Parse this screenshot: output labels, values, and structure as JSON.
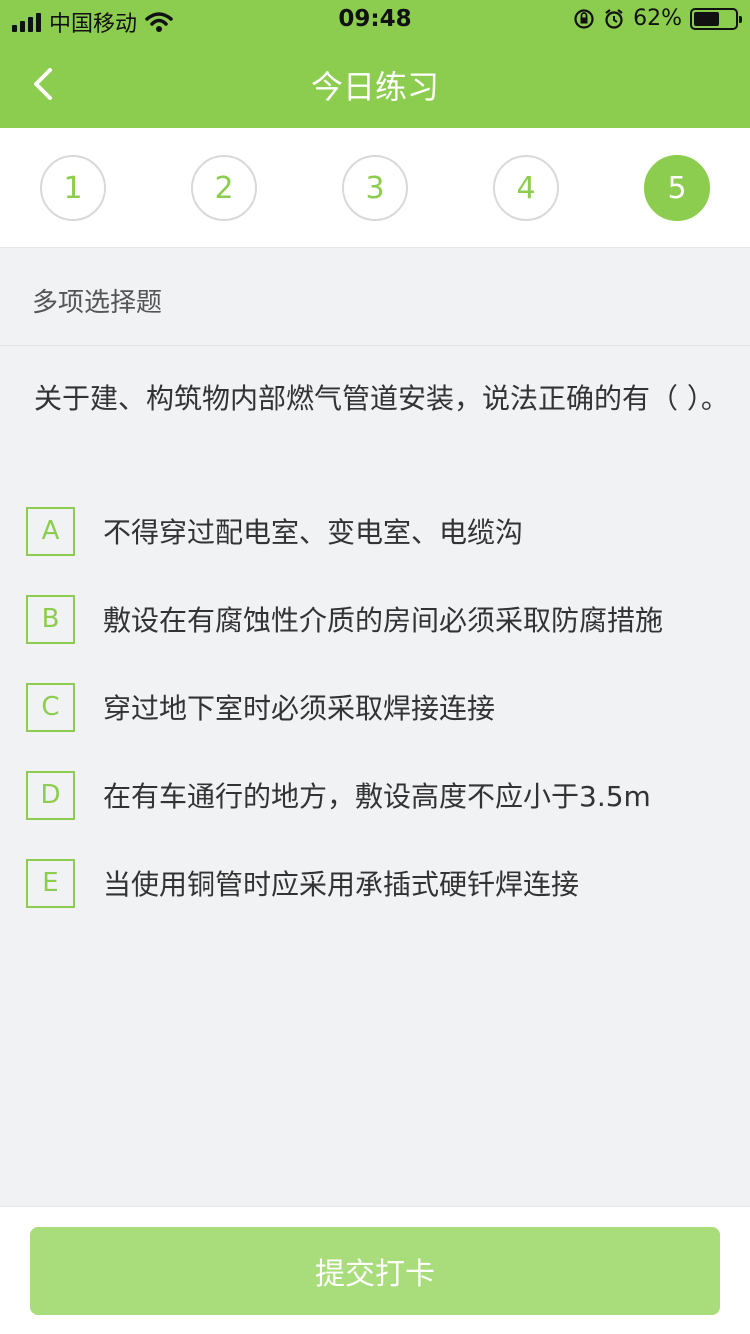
{
  "status_bar": {
    "carrier": "中国移动",
    "time": "09:48",
    "battery_percent": "62%",
    "battery_level": 0.62,
    "icons": [
      "signal-icon",
      "wifi-icon",
      "orientation-lock-icon",
      "alarm-icon",
      "battery-icon"
    ]
  },
  "nav": {
    "title": "今日练习",
    "back_icon": "chevron-left-icon"
  },
  "question_index": {
    "items": [
      "1",
      "2",
      "3",
      "4",
      "5"
    ],
    "active": "5"
  },
  "question": {
    "type": "多项选择题",
    "text": "关于建、构筑物内部燃气管道安装，说法正确的有（ ）。",
    "options": [
      {
        "key": "A",
        "text": "不得穿过配电室、变电室、电缆沟"
      },
      {
        "key": "B",
        "text": "敷设在有腐蚀性介质的房间必须采取防腐措施"
      },
      {
        "key": "C",
        "text": "穿过地下室时必须采取焊接连接"
      },
      {
        "key": "D",
        "text": "在有车通行的地方，敷设高度不应小于3.5m"
      },
      {
        "key": "E",
        "text": "当使用铜管时应采用承插式硬钎焊连接"
      }
    ]
  },
  "footer": {
    "submit_label": "提交打卡"
  },
  "colors": {
    "accent": "#8ccd4f",
    "submit_disabled": "#a9dd7c",
    "background": "#f1f2f4"
  }
}
